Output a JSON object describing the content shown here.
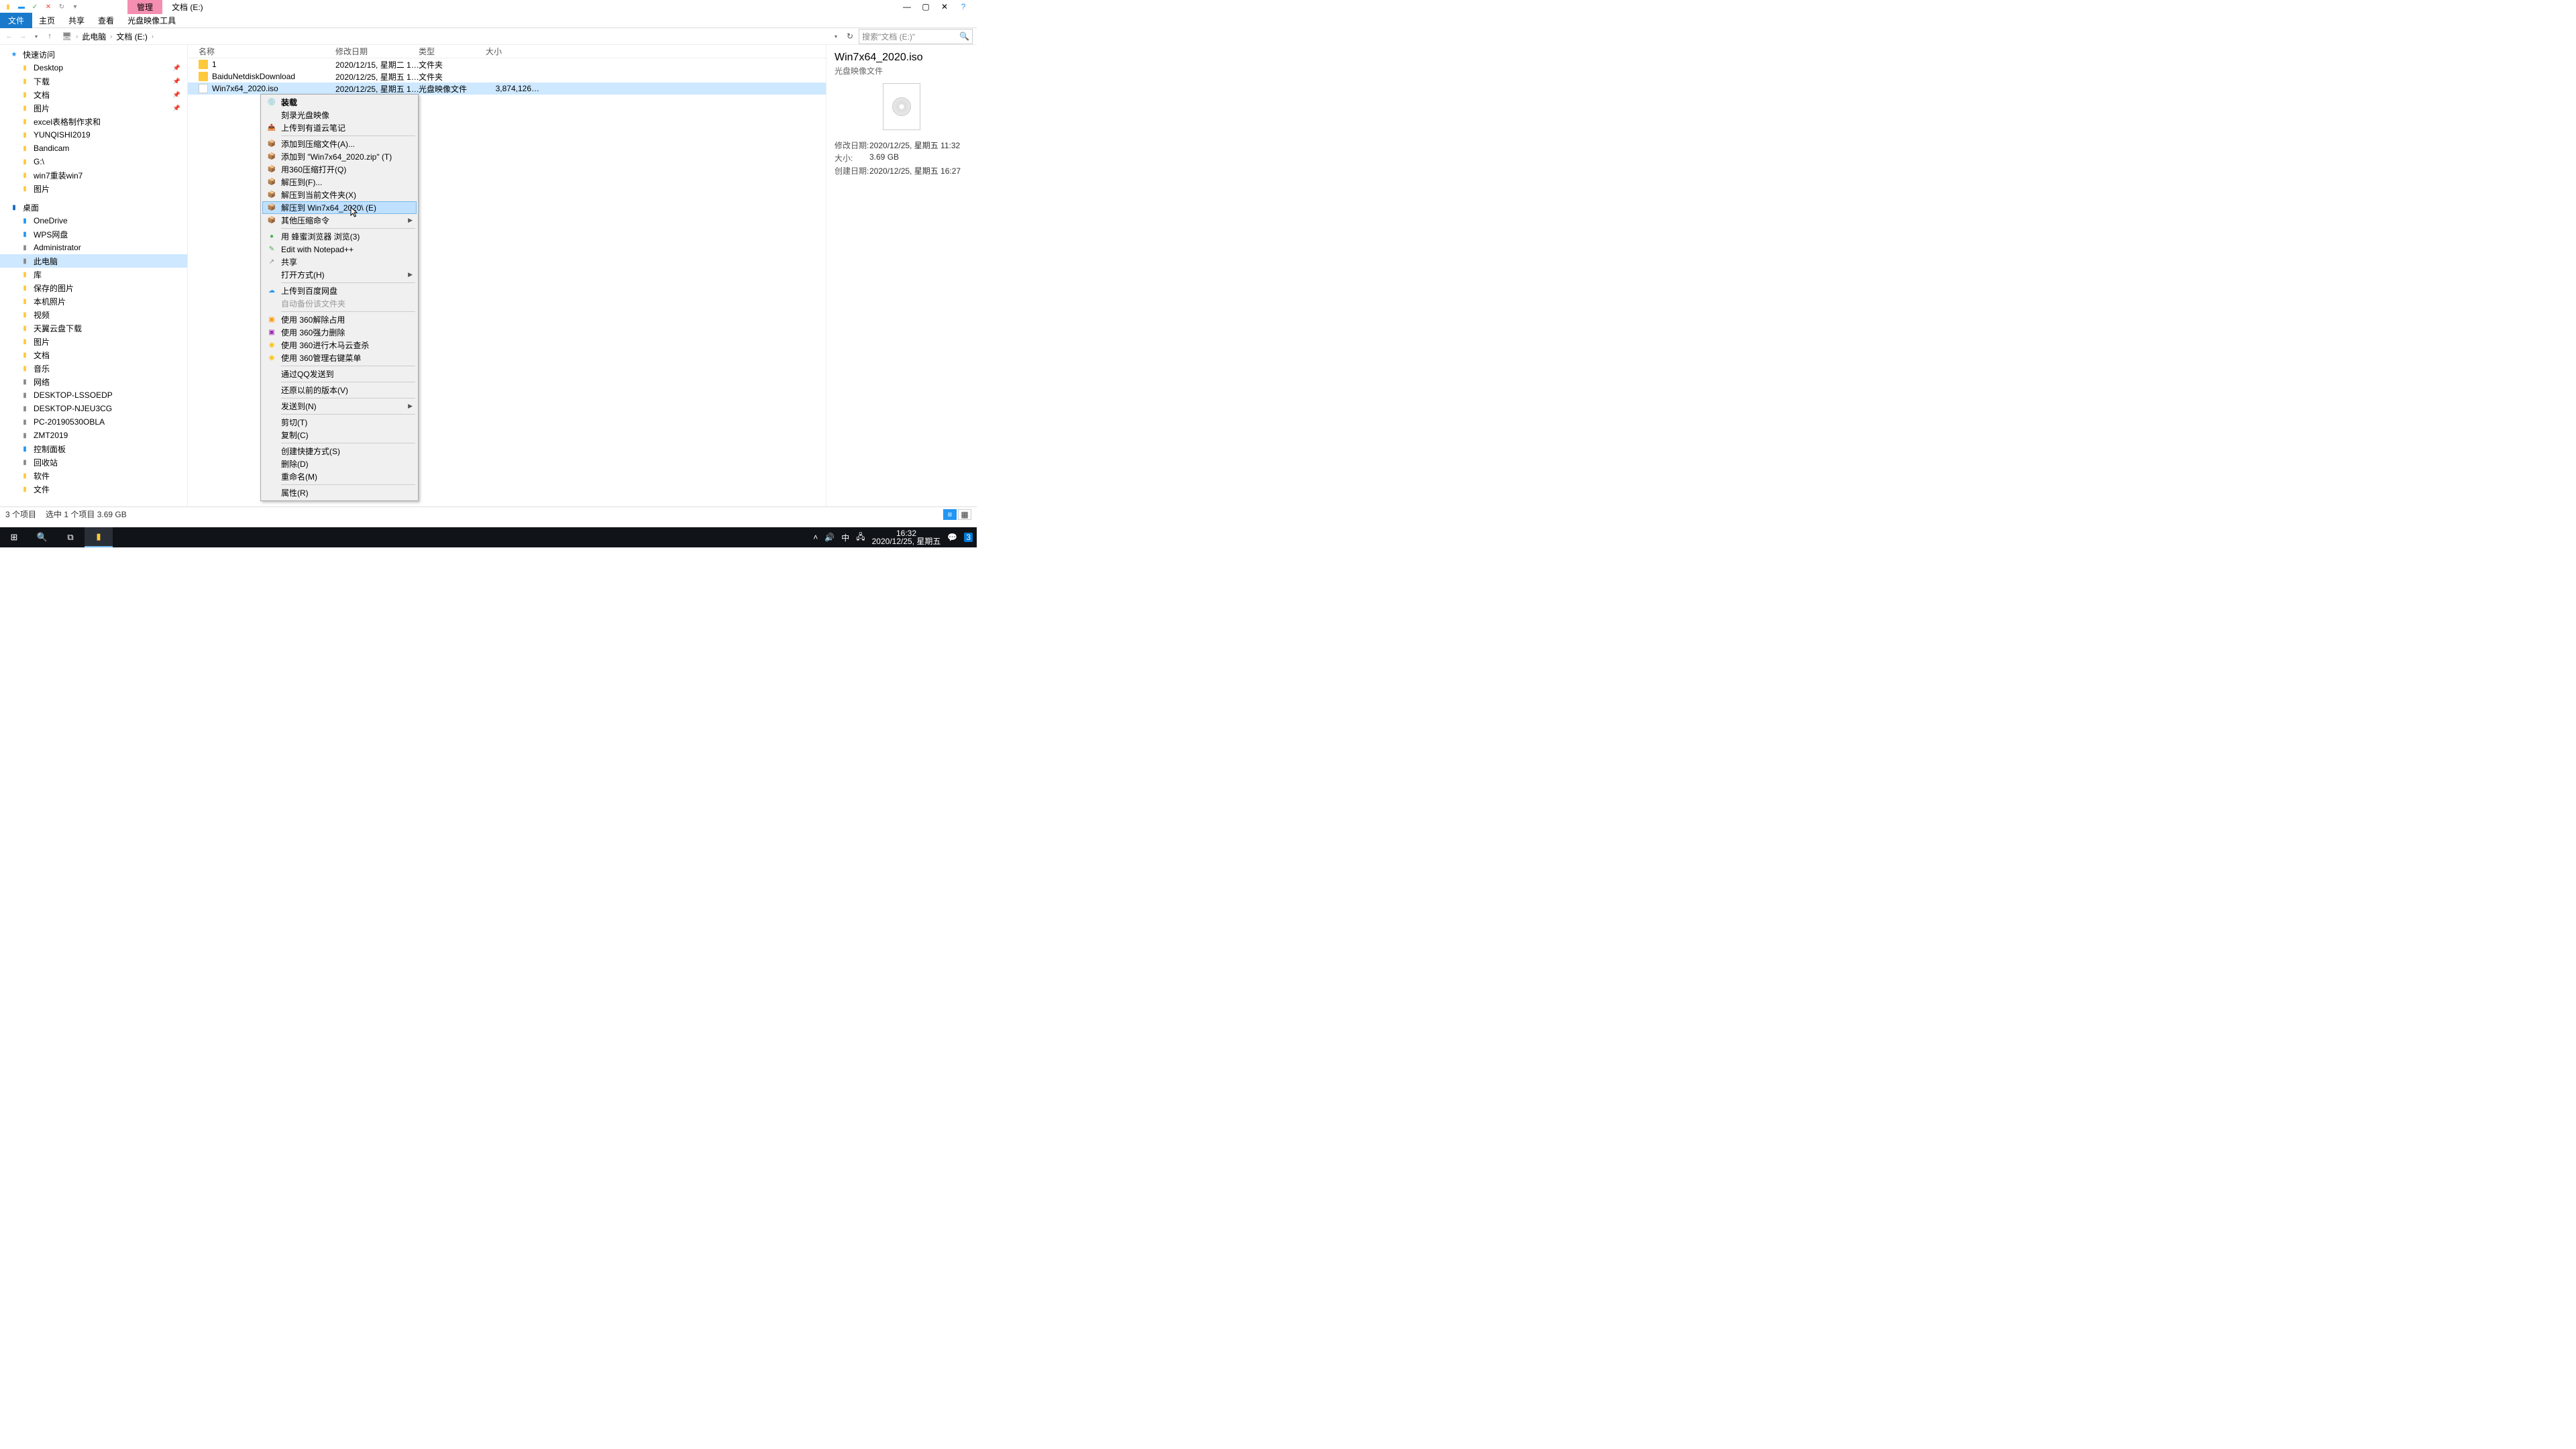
{
  "titlebar": {
    "manage_tab": "管理",
    "title": "文档 (E:)",
    "minimize": "—",
    "maximize": "▢",
    "close": "✕",
    "help": "?"
  },
  "ribbon": {
    "file": "文件",
    "home": "主页",
    "share": "共享",
    "view": "查看",
    "tools": "光盘映像工具"
  },
  "addr": {
    "this_pc": "此电脑",
    "loc": "文档 (E:)",
    "search_placeholder": "搜索\"文档 (E:)\""
  },
  "nav": {
    "quick": "快速访问",
    "items1": [
      "Desktop",
      "下载",
      "文档",
      "图片",
      "excel表格制作求和",
      "YUNQISHI2019",
      "Bandicam",
      "G:\\",
      "win7重装win7",
      "图片"
    ],
    "pinned": [
      true,
      true,
      true,
      true,
      false,
      false,
      false,
      false,
      false,
      false
    ],
    "desktop": "桌面",
    "items2": [
      "OneDrive",
      "WPS网盘",
      "Administrator",
      "此电脑",
      "库",
      "保存的图片",
      "本机照片",
      "视频",
      "天翼云盘下载",
      "图片",
      "文档",
      "音乐",
      "网络",
      "DESKTOP-LSSOEDP",
      "DESKTOP-NJEU3CG",
      "PC-20190530OBLA",
      "ZMT2019",
      "控制面板",
      "回收站",
      "软件",
      "文件"
    ]
  },
  "cols": {
    "name": "名称",
    "date": "修改日期",
    "type": "类型",
    "size": "大小"
  },
  "files": [
    {
      "name": "1",
      "date": "2020/12/15, 星期二 1…",
      "type": "文件夹",
      "size": "",
      "kind": "folder"
    },
    {
      "name": "BaiduNetdiskDownload",
      "date": "2020/12/25, 星期五 1…",
      "type": "文件夹",
      "size": "",
      "kind": "folder"
    },
    {
      "name": "Win7x64_2020.iso",
      "date": "2020/12/25, 星期五 1…",
      "type": "光盘映像文件",
      "size": "3,874,126…",
      "kind": "iso",
      "sel": true
    }
  ],
  "ctx": [
    {
      "t": "装载",
      "ico": "💿",
      "bold": true
    },
    {
      "t": "刻录光盘映像"
    },
    {
      "t": "上传到有道云笔记",
      "ico": "📤",
      "cls": "blue"
    },
    {
      "sep": true
    },
    {
      "t": "添加到压缩文件(A)...",
      "ico": "📦",
      "cls": "orange"
    },
    {
      "t": "添加到 \"Win7x64_2020.zip\" (T)",
      "ico": "📦",
      "cls": "orange"
    },
    {
      "t": "用360压缩打开(Q)",
      "ico": "📦",
      "cls": "orange"
    },
    {
      "t": "解压到(F)...",
      "ico": "📦",
      "cls": "orange"
    },
    {
      "t": "解压到当前文件夹(X)",
      "ico": "📦",
      "cls": "orange"
    },
    {
      "t": "解压到 Win7x64_2020\\ (E)",
      "ico": "📦",
      "cls": "orange",
      "hl": true
    },
    {
      "t": "其他压缩命令",
      "ico": "📦",
      "cls": "orange",
      "arrow": true
    },
    {
      "sep": true
    },
    {
      "t": "用 蜂蜜浏览器 浏览(3)",
      "ico": "●",
      "cls": "green"
    },
    {
      "t": "Edit with Notepad++",
      "ico": "✎",
      "cls": "green"
    },
    {
      "t": "共享",
      "ico": "↗",
      "cls": "gray"
    },
    {
      "t": "打开方式(H)",
      "arrow": true
    },
    {
      "sep": true
    },
    {
      "t": "上传到百度网盘",
      "ico": "☁",
      "cls": "blue"
    },
    {
      "t": "自动备份该文件夹",
      "dis": true
    },
    {
      "sep": true
    },
    {
      "t": "使用 360解除占用",
      "ico": "▣",
      "cls": "orange"
    },
    {
      "t": "使用 360强力删除",
      "ico": "▣",
      "cls": "purple"
    },
    {
      "t": "使用 360进行木马云查杀",
      "ico": "◉",
      "cls": "yellow"
    },
    {
      "t": "使用 360管理右键菜单",
      "ico": "◉",
      "cls": "yellow"
    },
    {
      "sep": true
    },
    {
      "t": "通过QQ发送到"
    },
    {
      "sep": true
    },
    {
      "t": "还原以前的版本(V)"
    },
    {
      "sep": true
    },
    {
      "t": "发送到(N)",
      "arrow": true
    },
    {
      "sep": true
    },
    {
      "t": "剪切(T)"
    },
    {
      "t": "复制(C)"
    },
    {
      "sep": true
    },
    {
      "t": "创建快捷方式(S)"
    },
    {
      "t": "删除(D)"
    },
    {
      "t": "重命名(M)"
    },
    {
      "sep": true
    },
    {
      "t": "属性(R)"
    }
  ],
  "details": {
    "name": "Win7x64_2020.iso",
    "type": "光盘映像文件",
    "kv": [
      {
        "k": "修改日期:",
        "v": "2020/12/25, 星期五 11:32"
      },
      {
        "k": "大小:",
        "v": "3.69 GB"
      },
      {
        "k": "创建日期:",
        "v": "2020/12/25, 星期五 16:27"
      }
    ]
  },
  "status": {
    "count": "3 个项目",
    "sel": "选中 1 个项目  3.69 GB"
  },
  "taskbar": {
    "time": "16:32",
    "date": "2020/12/25, 星期五",
    "ime": "中",
    "notif": "3"
  }
}
